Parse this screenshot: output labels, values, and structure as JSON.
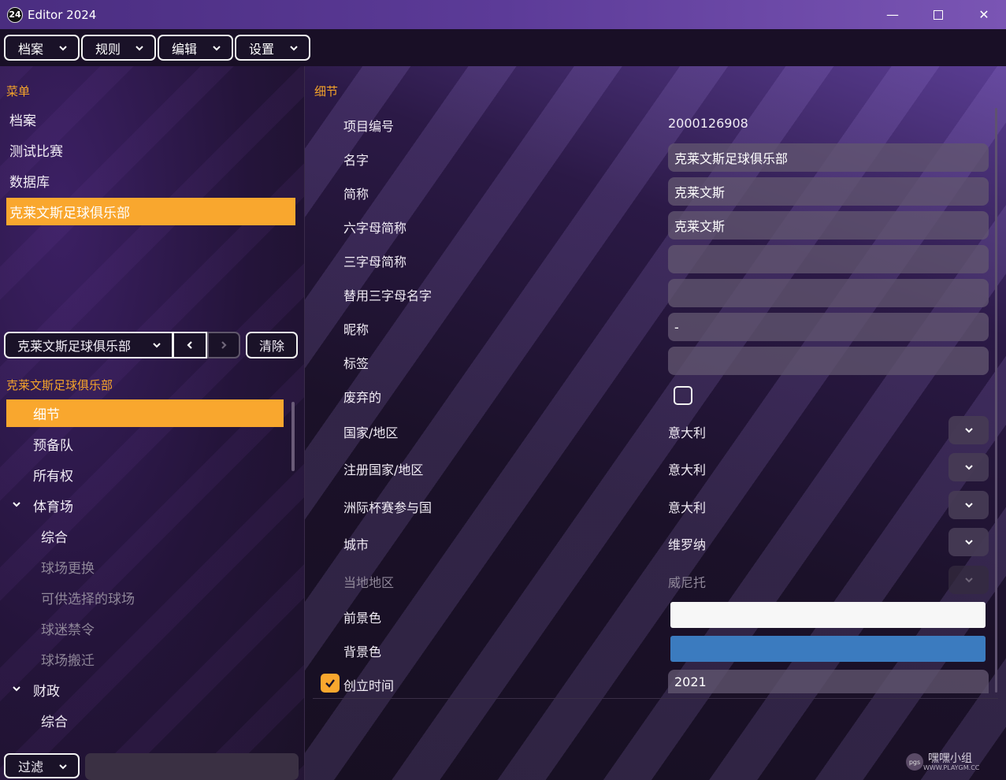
{
  "window": {
    "app_icon": "24",
    "title": "Editor 2024",
    "minimize": "—",
    "close": "✕"
  },
  "menubar": [
    {
      "label": "档案"
    },
    {
      "label": "规则"
    },
    {
      "label": "编辑"
    },
    {
      "label": "设置"
    }
  ],
  "left": {
    "menu_heading": "菜单",
    "menu_items": [
      "档案",
      "测试比赛",
      "数据库",
      "克莱文斯足球俱乐部"
    ],
    "selector": {
      "value": "克莱文斯足球俱乐部",
      "clear_label": "清除"
    },
    "club_heading": "克莱文斯足球俱乐部",
    "tree": [
      {
        "label": "细节",
        "state": "selected"
      },
      {
        "label": "预备队"
      },
      {
        "label": "所有权"
      },
      {
        "label": "体育场",
        "expanded": true
      },
      {
        "label": "综合"
      },
      {
        "label": "球场更换",
        "state": "dim"
      },
      {
        "label": "可供选择的球场",
        "state": "dim"
      },
      {
        "label": "球迷禁令",
        "state": "dim"
      },
      {
        "label": "球场搬迁",
        "state": "dim"
      },
      {
        "label": "财政",
        "expanded": true
      },
      {
        "label": "综合"
      }
    ],
    "filter": {
      "label": "过滤",
      "value": ""
    }
  },
  "details": {
    "heading": "细节",
    "id_label": "项目编号",
    "id_value": "2000126908",
    "name_label": "名字",
    "name_value": "克莱文斯足球俱乐部",
    "short_label": "简称",
    "short_value": "克莱文斯",
    "six_label": "六字母简称",
    "six_value": "克莱文斯",
    "three_label": "三字母简称",
    "three_value": "",
    "alt_three_label": "替用三字母名字",
    "alt_three_value": "",
    "nickname_label": "昵称",
    "nickname_value": "-",
    "tag_label": "标签",
    "tag_value": "",
    "discarded_label": "废弃的",
    "country_label": "国家/地区",
    "country_value": "意大利",
    "reg_country_label": "注册国家/地区",
    "reg_country_value": "意大利",
    "continental_label": "洲际杯赛参与国",
    "continental_value": "意大利",
    "city_label": "城市",
    "city_value": "维罗纳",
    "region_label": "当地地区",
    "region_value": "威尼托",
    "fg_label": "前景色",
    "fg_color": "#f7f7f7",
    "bg_label": "背景色",
    "bg_color": "#3b7bbf",
    "founded_label": "创立时间",
    "founded_value": "2021"
  },
  "colors": {
    "accent": "#f9a72e"
  },
  "watermark": {
    "badge": "pgs",
    "text": "嘿嘿小组",
    "sub": "WWW.PLAYGM.CC"
  }
}
